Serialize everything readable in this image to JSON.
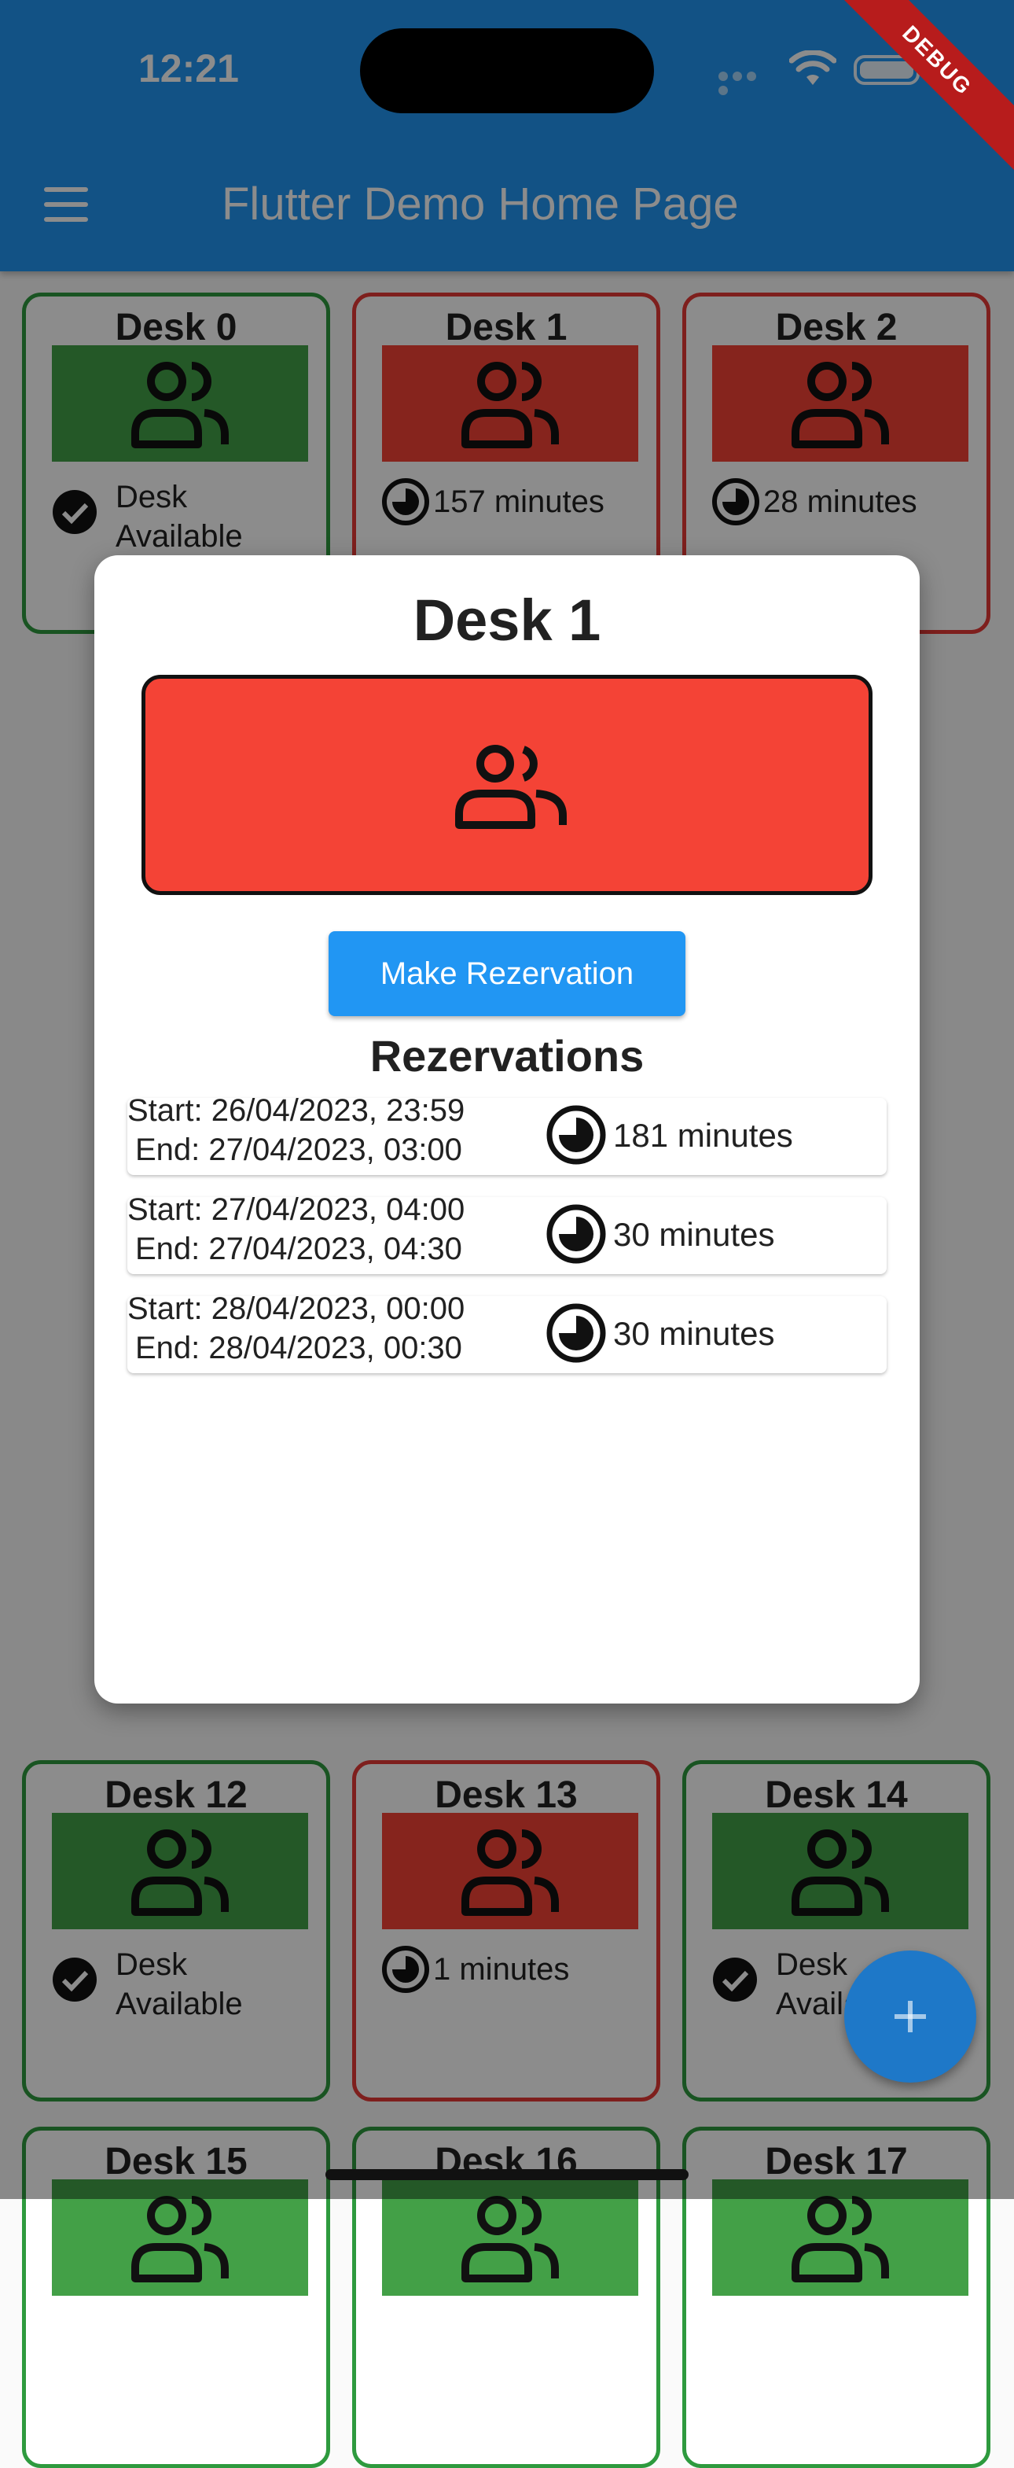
{
  "status_bar": {
    "time": "12:21"
  },
  "app_bar": {
    "title": "Flutter Demo Home Page",
    "debug_banner": "DEBUG"
  },
  "colors": {
    "available": "#43a047",
    "occupied": "#f44336",
    "primary": "#2196f3"
  },
  "desks": [
    {
      "label": "Desk 0",
      "state": "available",
      "status": "Desk Available"
    },
    {
      "label": "Desk 1",
      "state": "occupied",
      "status": "157 minutes"
    },
    {
      "label": "Desk 2",
      "state": "occupied",
      "status": "28 minutes"
    },
    {
      "label": "Desk 12",
      "state": "available",
      "status": "Desk Available"
    },
    {
      "label": "Desk 13",
      "state": "occupied",
      "status": "1 minutes"
    },
    {
      "label": "Desk 14",
      "state": "available",
      "status": "Desk Available"
    },
    {
      "label": "Desk 15",
      "state": "available",
      "status": ""
    },
    {
      "label": "Desk 16",
      "state": "available",
      "status": ""
    },
    {
      "label": "Desk 17",
      "state": "available",
      "status": ""
    }
  ],
  "dialog": {
    "title": "Desk 1",
    "button_label": "Make Rezervation",
    "reservations_title": "Rezervations",
    "reservations": [
      {
        "start": "Start: 26/04/2023, 23:59",
        "end": "End: 27/04/2023, 03:00",
        "duration": "181 minutes"
      },
      {
        "start": "Start: 27/04/2023, 04:00",
        "end": "End: 27/04/2023, 04:30",
        "duration": "30 minutes"
      },
      {
        "start": "Start: 28/04/2023, 00:00",
        "end": "End: 28/04/2023, 00:30",
        "duration": "30 minutes"
      }
    ]
  },
  "fab": {
    "icon": "add-icon"
  }
}
